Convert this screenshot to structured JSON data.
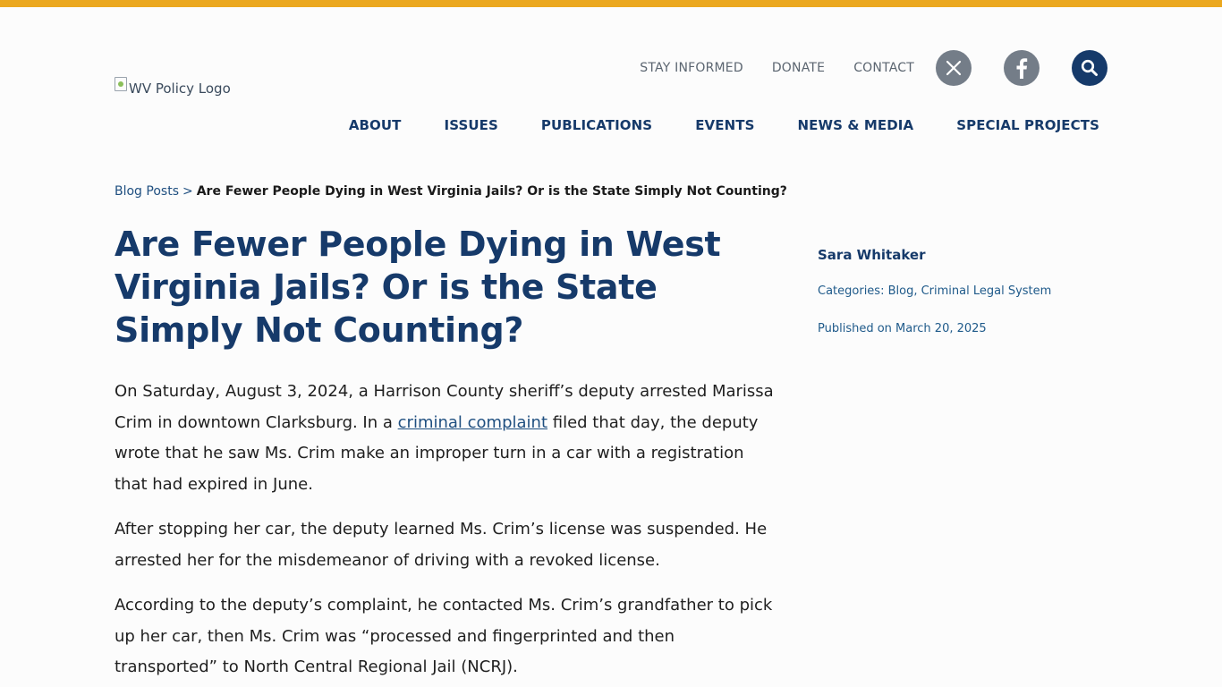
{
  "colors": {
    "accent_bar": "#eba81f",
    "brand_navy": "#163a6a",
    "social_grey": "#747d88",
    "link_blue": "#1f4f80"
  },
  "header": {
    "logo_alt": "WV Policy Logo",
    "utility_links": [
      "STAY INFORMED",
      "DONATE",
      "CONTACT"
    ],
    "social": {
      "x_icon": "x-icon",
      "facebook_icon": "facebook-icon",
      "search_icon": "search-icon"
    },
    "main_nav": [
      "ABOUT",
      "ISSUES",
      "PUBLICATIONS",
      "EVENTS",
      "NEWS & MEDIA",
      "SPECIAL PROJECTS"
    ]
  },
  "breadcrumb": {
    "parent": "Blog Posts",
    "separator": ">",
    "current": "Are Fewer People Dying in West Virginia Jails? Or is the State Simply Not Counting?"
  },
  "article": {
    "title": "Are Fewer People Dying in West Virginia Jails? Or is the State Simply Not Counting?",
    "p1_before": "On Saturday, August 3, 2024, a Harrison County sheriff’s deputy arrested Marissa Crim in downtown Clarksburg. In a ",
    "p1_link": "criminal complaint",
    "p1_after": " filed that day, the deputy wrote that he saw Ms. Crim make an improper turn in a car with a registration that had expired in June.",
    "p2": "After stopping her car, the deputy learned Ms. Crim’s license was suspended. He arrested her for the misdemeanor of driving with a revoked license.",
    "p3": "According to the deputy’s complaint, he contacted Ms. Crim’s grandfather to pick up her car, then Ms. Crim was “processed and fingerprinted and then transported” to North Central Regional Jail (NCRJ)."
  },
  "sidebar": {
    "author": "Sara Whitaker",
    "categories_label": "Categories:",
    "categories": [
      "Blog",
      "Criminal Legal System"
    ],
    "published": "Published on March 20, 2025"
  }
}
